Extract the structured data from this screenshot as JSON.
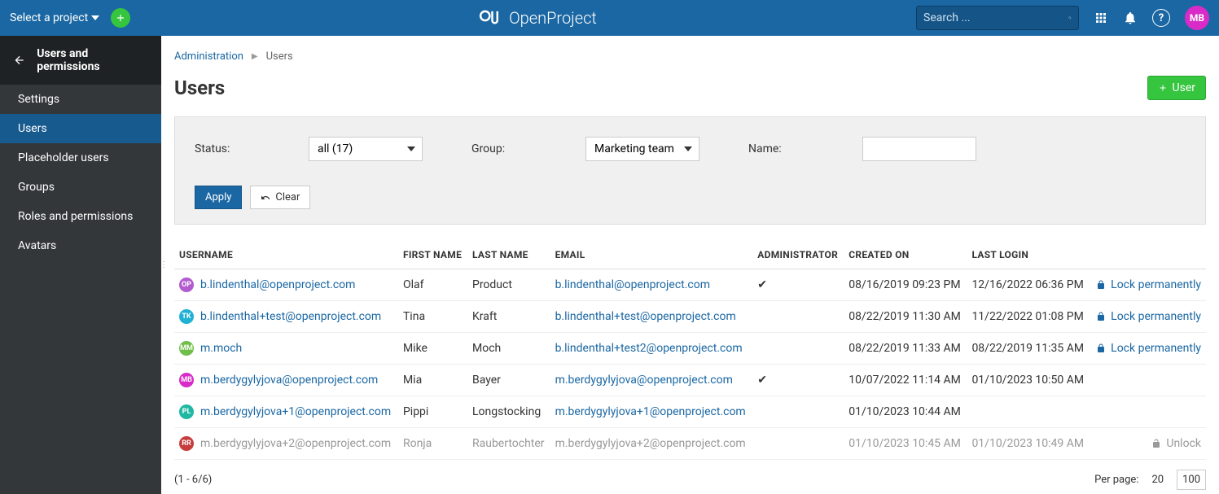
{
  "topbar": {
    "project_select": "Select a project",
    "logo_text": "OpenProject",
    "search_placeholder": "Search ...",
    "avatar_initials": "MB"
  },
  "sidebar": {
    "title": "Users and permissions",
    "items": [
      {
        "label": "Settings"
      },
      {
        "label": "Users"
      },
      {
        "label": "Placeholder users"
      },
      {
        "label": "Groups"
      },
      {
        "label": "Roles and permissions"
      },
      {
        "label": "Avatars"
      }
    ]
  },
  "breadcrumb": {
    "root": "Administration",
    "current": "Users"
  },
  "page": {
    "title": "Users",
    "new_user_btn": "User"
  },
  "filters": {
    "status_label": "Status:",
    "status_value": "all (17)",
    "group_label": "Group:",
    "group_value": "Marketing team",
    "name_label": "Name:",
    "apply_label": "Apply",
    "clear_label": "Clear"
  },
  "table": {
    "headers": {
      "username": "USERNAME",
      "first_name": "FIRST NAME",
      "last_name": "LAST NAME",
      "email": "EMAIL",
      "admin": "ADMINISTRATOR",
      "created": "CREATED ON",
      "last_login": "LAST LOGIN"
    },
    "rows": [
      {
        "avatar": "OP",
        "avatar_color": "#b25bce",
        "username": "b.lindenthal@openproject.com",
        "first_name": "Olaf",
        "last_name": "Product",
        "email": "b.lindenthal@openproject.com",
        "admin": true,
        "created": "08/16/2019 09:23 PM",
        "last_login": "12/16/2022 06:36 PM",
        "action": "Lock permanently",
        "locked": true,
        "muted": false
      },
      {
        "avatar": "TK",
        "avatar_color": "#1fb0d2",
        "username": "b.lindenthal+test@openproject.com",
        "first_name": "Tina",
        "last_name": "Kraft",
        "email": "b.lindenthal+test@openproject.com",
        "admin": false,
        "created": "08/22/2019 11:30 AM",
        "last_login": "11/22/2022 01:08 PM",
        "action": "Lock permanently",
        "locked": true,
        "muted": false
      },
      {
        "avatar": "MM",
        "avatar_color": "#6fbe4a",
        "username": "m.moch",
        "first_name": "Mike",
        "last_name": "Moch",
        "email": "b.lindenthal+test2@openproject.com",
        "admin": false,
        "created": "08/22/2019 11:33 AM",
        "last_login": "08/22/2019 11:35 AM",
        "action": "Lock permanently",
        "locked": true,
        "muted": false
      },
      {
        "avatar": "MB",
        "avatar_color": "#d82bc7",
        "username": "m.berdygylyjova@openproject.com",
        "first_name": "Mia",
        "last_name": "Bayer",
        "email": "m.berdygylyjova@openproject.com",
        "admin": true,
        "created": "10/07/2022 11:14 AM",
        "last_login": "01/10/2023 10:50 AM",
        "action": "",
        "locked": false,
        "muted": false
      },
      {
        "avatar": "PL",
        "avatar_color": "#1fb8a3",
        "username": "m.berdygylyjova+1@openproject.com",
        "first_name": "Pippi",
        "last_name": "Longstocking",
        "email": "m.berdygylyjova+1@openproject.com",
        "admin": false,
        "created": "01/10/2023 10:44 AM",
        "last_login": "",
        "action": "",
        "locked": false,
        "muted": false
      },
      {
        "avatar": "RR",
        "avatar_color": "#c73c3c",
        "username": "m.berdygylyjova+2@openproject.com",
        "first_name": "Ronja",
        "last_name": "Raubertochter",
        "email": "m.berdygylyjova+2@openproject.com",
        "admin": false,
        "created": "01/10/2023 10:45 AM",
        "last_login": "01/10/2023 10:49 AM",
        "action": "Unlock",
        "locked": false,
        "muted": true
      }
    ]
  },
  "pager": {
    "range": "(1 - 6/6)",
    "per_page_label": "Per page:",
    "options": [
      "20",
      "100"
    ]
  }
}
